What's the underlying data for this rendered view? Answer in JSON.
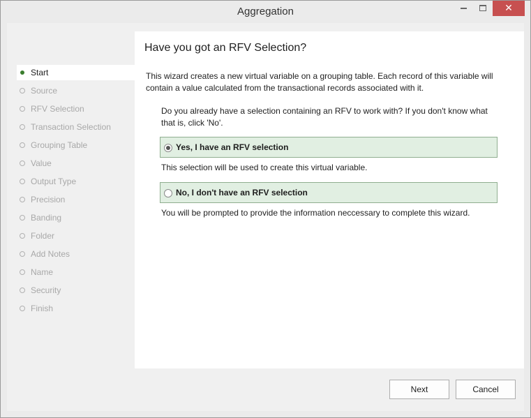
{
  "window": {
    "title": "Aggregation"
  },
  "titlebar": {
    "minimize": "–",
    "maximize": "□",
    "close": "✕"
  },
  "steps": [
    {
      "label": "Start",
      "state": "current"
    },
    {
      "label": "Source",
      "state": "pending"
    },
    {
      "label": "RFV Selection",
      "state": "pending"
    },
    {
      "label": "Transaction Selection",
      "state": "pending"
    },
    {
      "label": "Grouping Table",
      "state": "pending"
    },
    {
      "label": "Value",
      "state": "pending"
    },
    {
      "label": "Output Type",
      "state": "pending"
    },
    {
      "label": "Precision",
      "state": "pending"
    },
    {
      "label": "Banding",
      "state": "pending"
    },
    {
      "label": "Folder",
      "state": "pending"
    },
    {
      "label": "Add Notes",
      "state": "pending"
    },
    {
      "label": "Name",
      "state": "pending"
    },
    {
      "label": "Security",
      "state": "pending"
    },
    {
      "label": "Finish",
      "state": "pending"
    }
  ],
  "page": {
    "heading": "Have you got an RFV Selection?",
    "description": "This wizard creates a new virtual variable on a grouping table. Each record of this variable will contain a value calculated from the transactional records associated with it.",
    "question": "Do you already have a selection containing an RFV to work with? If you don't know what that is, click 'No'.",
    "options": [
      {
        "label": "Yes, I have an RFV selection",
        "hint": "This selection will be used to create this virtual variable.",
        "selected": true
      },
      {
        "label": "No, I don't have an RFV selection",
        "hint": "You will be prompted to provide the information neccessary to complete this wizard.",
        "selected": false
      }
    ]
  },
  "footer": {
    "next_label": "Next",
    "cancel_label": "Cancel"
  },
  "colors": {
    "close_button": "#c75050",
    "option_bg": "#e1efe2",
    "option_border": "#8fae8f",
    "active_dot": "#3a7d2e"
  }
}
